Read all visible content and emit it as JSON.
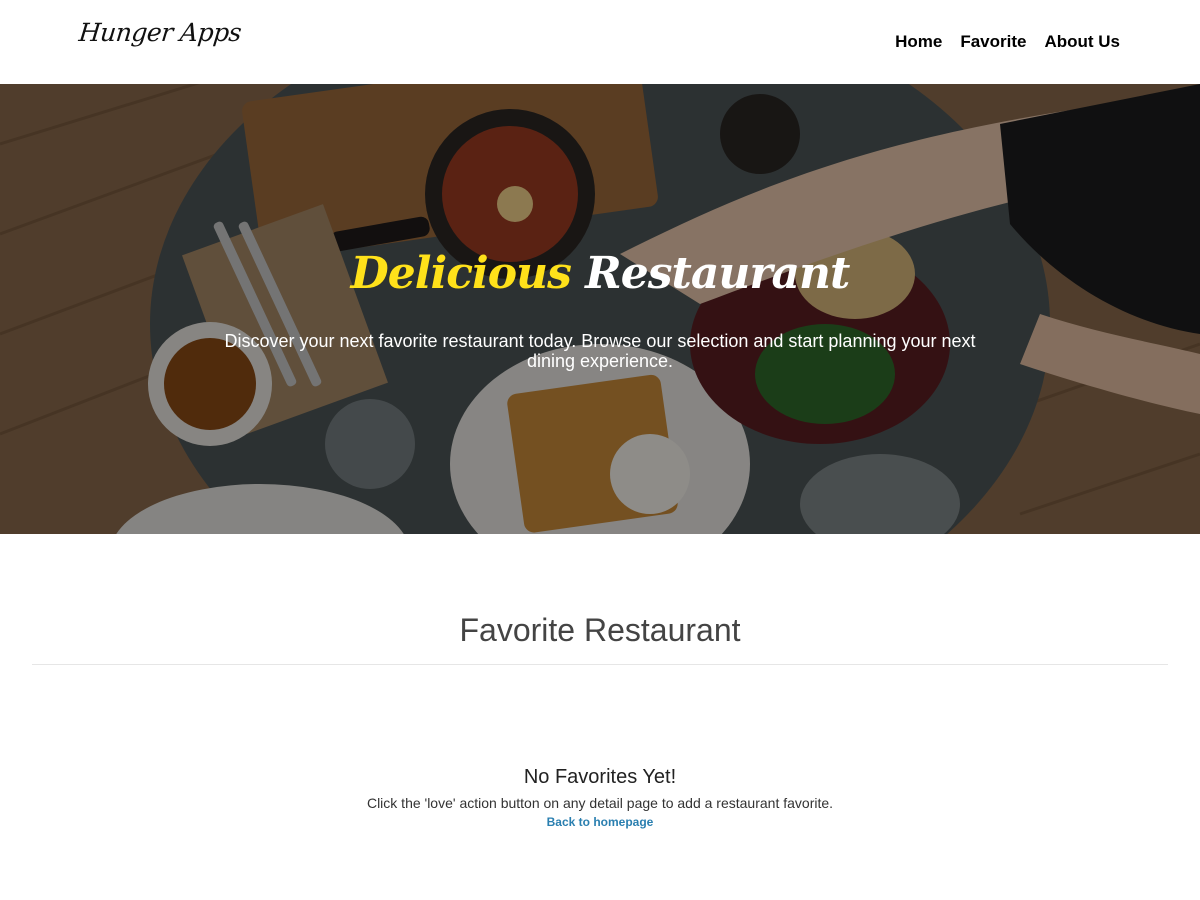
{
  "header": {
    "logo": "Hunger Apps",
    "nav": [
      {
        "label": "Home"
      },
      {
        "label": "Favorite"
      },
      {
        "label": "About Us"
      }
    ]
  },
  "hero": {
    "title_highlight": "Delicious",
    "title_rest": "Restaurant",
    "description": "Discover your next favorite restaurant today. Browse our selection and start planning your next dining experience."
  },
  "main": {
    "section_title": "Favorite Restaurant",
    "empty_state": {
      "title": "No Favorites Yet!",
      "message": "Click the 'love' action button on any detail page to add a restaurant favorite.",
      "link_label": "Back to homepage"
    }
  },
  "colors": {
    "accent_yellow": "#ffe11a",
    "link_blue": "#2a7fb0"
  }
}
